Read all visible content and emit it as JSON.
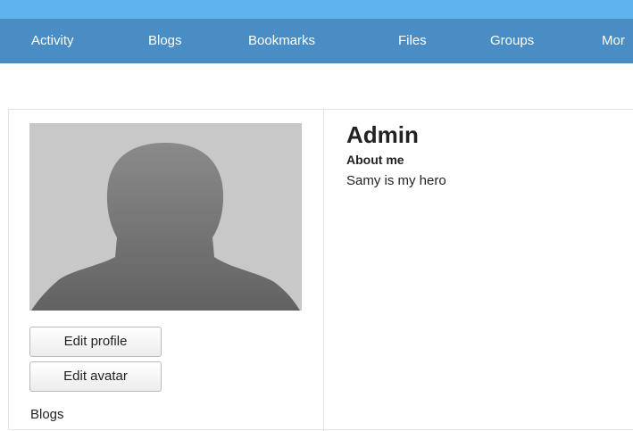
{
  "nav": {
    "items": [
      "Activity",
      "Blogs",
      "Bookmarks",
      "Files",
      "Groups",
      "Mor"
    ]
  },
  "profile": {
    "name": "Admin",
    "about_label": "About me",
    "about_text": "Samy is my hero"
  },
  "sidebar": {
    "edit_profile": "Edit profile",
    "edit_avatar": "Edit avatar",
    "blogs_link": "Blogs"
  },
  "colors": {
    "topbar": "#5fb4f0",
    "navbar": "#4a8dc4",
    "avatar_bg": "#c8c8c8",
    "silhouette": "#6e6e6e"
  },
  "icons": {
    "avatar": "person-silhouette-icon"
  }
}
